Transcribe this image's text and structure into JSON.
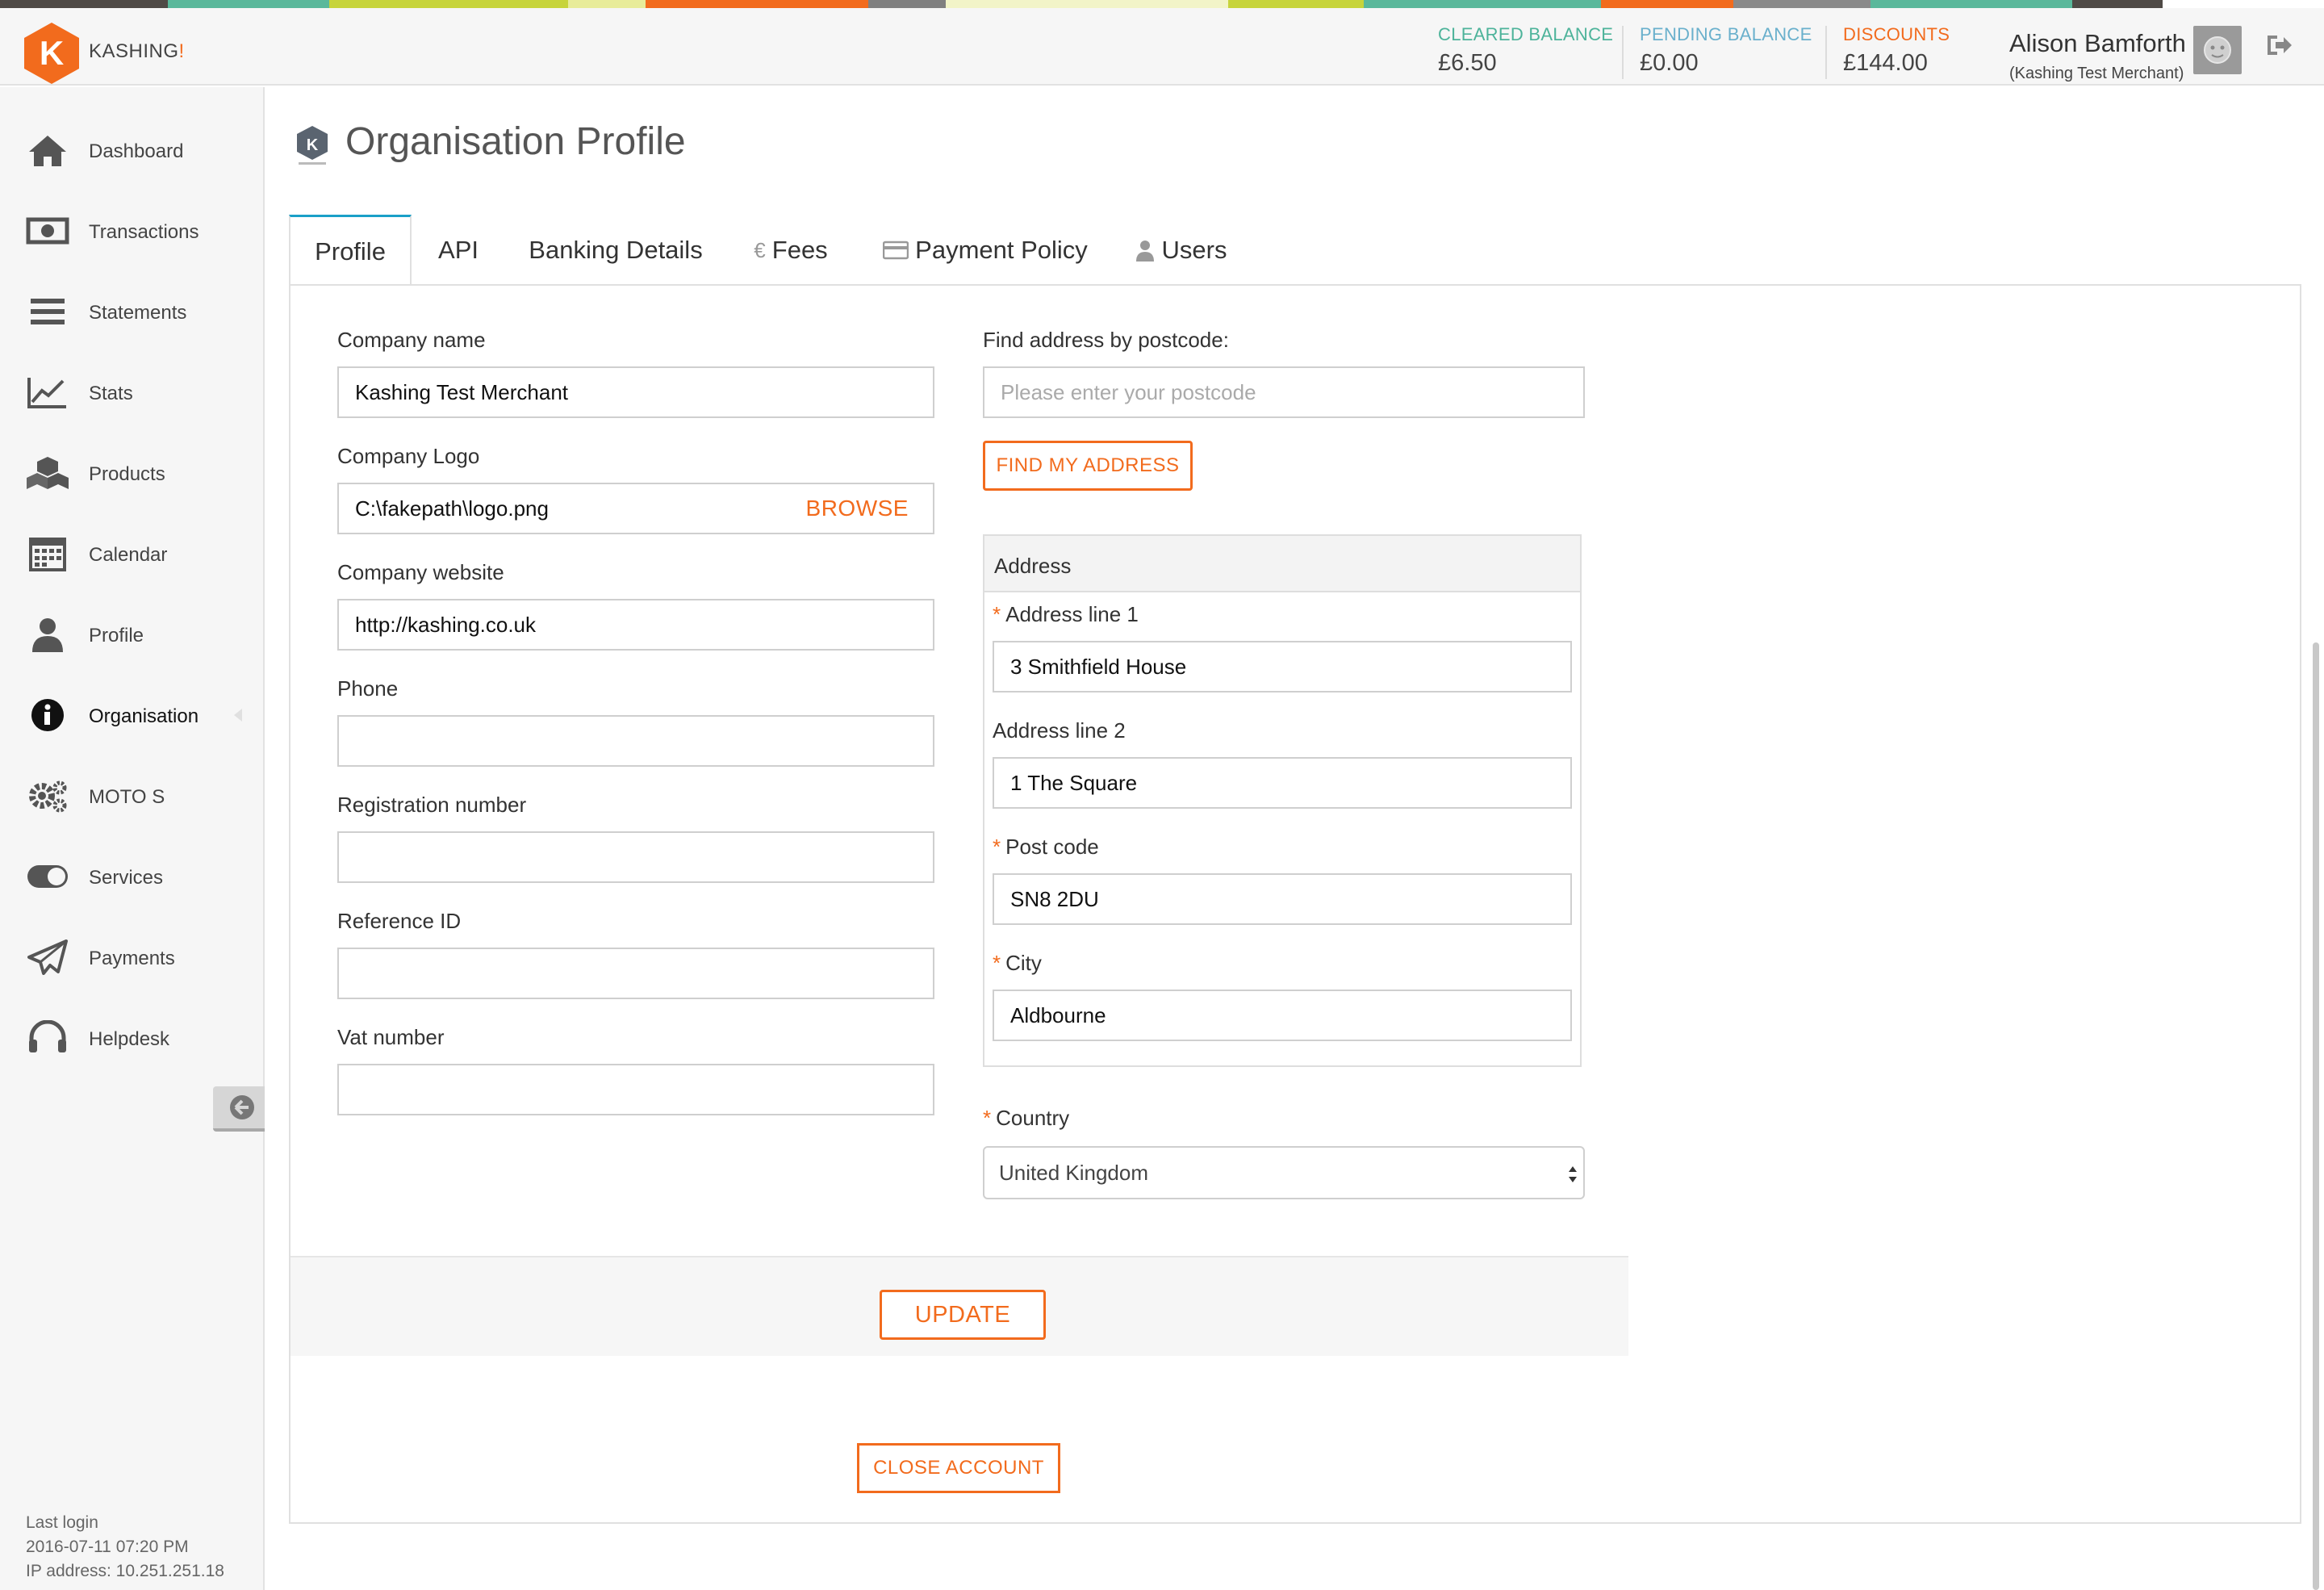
{
  "stripe_colors": [
    "#4f4a46",
    "#5ab89b",
    "#c7d43b",
    "#e8ec9a",
    "#f26b1d",
    "#808080",
    "#f2f4c8",
    "#c7d43b",
    "#5ab89b",
    "#f26b1d",
    "#8a8a8a",
    "#5ab89b",
    "#4f4a46"
  ],
  "brand": {
    "name": "KASHING",
    "bang": "!",
    "accent": "#f26b1d"
  },
  "balances": [
    {
      "label": "CLEARED BALANCE",
      "value": "£6.50",
      "color": "#4db39a"
    },
    {
      "label": "PENDING BALANCE",
      "value": "£0.00",
      "color": "#6ab0cc"
    },
    {
      "label": "DISCOUNTS",
      "value": "£144.00",
      "color": "#f26b1d"
    }
  ],
  "user": {
    "name": "Alison Bamforth",
    "merchant": "(Kashing Test Merchant)"
  },
  "sidebar": {
    "items": [
      {
        "label": "Dashboard",
        "icon": "home-icon"
      },
      {
        "label": "Transactions",
        "icon": "banknote-icon"
      },
      {
        "label": "Statements",
        "icon": "list-icon"
      },
      {
        "label": "Stats",
        "icon": "chart-icon"
      },
      {
        "label": "Products",
        "icon": "boxes-icon"
      },
      {
        "label": "Calendar",
        "icon": "calendar-icon"
      },
      {
        "label": "Profile",
        "icon": "user-icon"
      },
      {
        "label": "Organisation",
        "icon": "info-icon",
        "active": true
      },
      {
        "label": "MOTO S",
        "icon": "gears-icon"
      },
      {
        "label": "Services",
        "icon": "toggle-icon"
      },
      {
        "label": "Payments",
        "icon": "paper-plane-icon"
      },
      {
        "label": "Helpdesk",
        "icon": "headset-icon"
      }
    ],
    "last_login_label": "Last login",
    "last_login_time": "2016-07-11 07:20 PM",
    "ip_address": "IP address: 10.251.251.18"
  },
  "page": {
    "title": "Organisation Profile"
  },
  "tabs": [
    {
      "label": "Profile",
      "active": true
    },
    {
      "label": "API"
    },
    {
      "label": "Banking Details"
    },
    {
      "label": "Fees",
      "icon": "€"
    },
    {
      "label": "Payment Policy",
      "icon": "card-icon"
    },
    {
      "label": "Users",
      "icon": "user-icon"
    }
  ],
  "form": {
    "company_name": {
      "label": "Company name",
      "value": "Kashing Test Merchant"
    },
    "company_logo": {
      "label": "Company Logo",
      "value": "C:\\fakepath\\logo.png",
      "browse": "BROWSE"
    },
    "company_website": {
      "label": "Company website",
      "value": "http://kashing.co.uk"
    },
    "phone": {
      "label": "Phone",
      "value": ""
    },
    "registration_number": {
      "label": "Registration number",
      "value": ""
    },
    "reference_id": {
      "label": "Reference ID",
      "value": ""
    },
    "vat_number": {
      "label": "Vat number",
      "value": ""
    },
    "postcode_search": {
      "label": "Find address by postcode:",
      "placeholder": "Please enter your postcode",
      "button": "FIND MY ADDRESS"
    },
    "address": {
      "heading": "Address",
      "line1": {
        "label": "Address line 1",
        "value": "3 Smithfield House"
      },
      "line2": {
        "label": "Address line 2",
        "value": "1 The Square"
      },
      "postcode": {
        "label": "Post code",
        "value": "SN8 2DU"
      },
      "city": {
        "label": "City",
        "value": "Aldbourne"
      }
    },
    "country": {
      "label": "Country",
      "value": "United Kingdom"
    },
    "required_mark": "*",
    "update_button": "UPDATE",
    "close_account_button": "CLOSE ACCOUNT"
  }
}
